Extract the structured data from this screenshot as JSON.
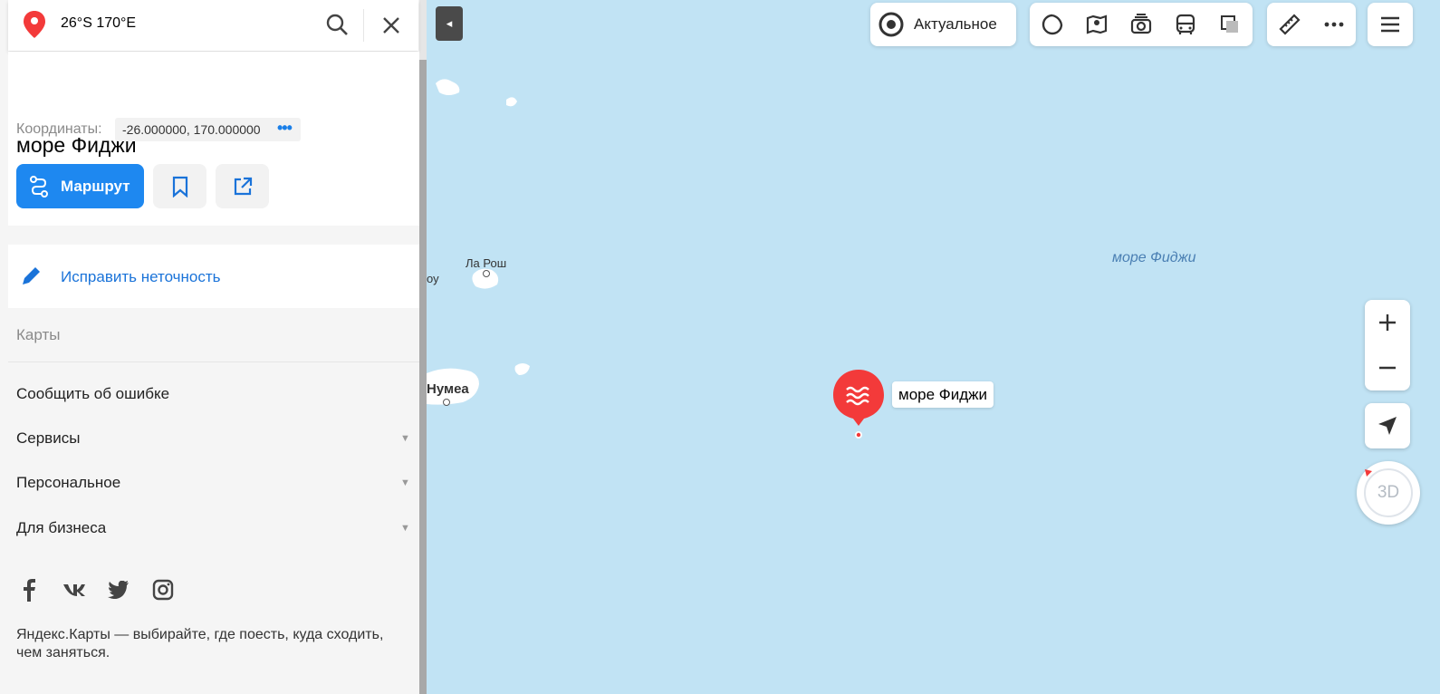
{
  "search": {
    "value": "26°S 170°E"
  },
  "place": {
    "title": "море Фиджи",
    "coord_label": "Координаты:",
    "coord_value": "-26.000000, 170.000000",
    "coord_more": "•••"
  },
  "actions": {
    "route_label": "Маршрут"
  },
  "fix": {
    "label": "Исправить неточность"
  },
  "maps_section": {
    "title": "Карты",
    "items": [
      {
        "label": "Сообщить об ошибке",
        "arrow": ""
      },
      {
        "label": "Сервисы",
        "arrow": "▼"
      },
      {
        "label": "Персональное",
        "arrow": "▼"
      },
      {
        "label": "Для бизнеса",
        "arrow": "▼"
      }
    ]
  },
  "footer": {
    "text": "Яндекс.Карты — выбирайте, где поесть, куда сходить, чем заняться."
  },
  "map": {
    "layer_label": "Актуальное",
    "labels": {
      "la_roche": "Ла Рош",
      "nouméa": "Нумеа",
      "partial": "оу",
      "sea": "море Фиджи",
      "pin": "море Фиджи"
    },
    "compass_label": "3D",
    "collapse_glyph": "◂"
  },
  "colors": {
    "accent": "#1e88f0",
    "pin": "#f33a3a",
    "water": "#c1e3f4",
    "link": "#1a73d9"
  }
}
